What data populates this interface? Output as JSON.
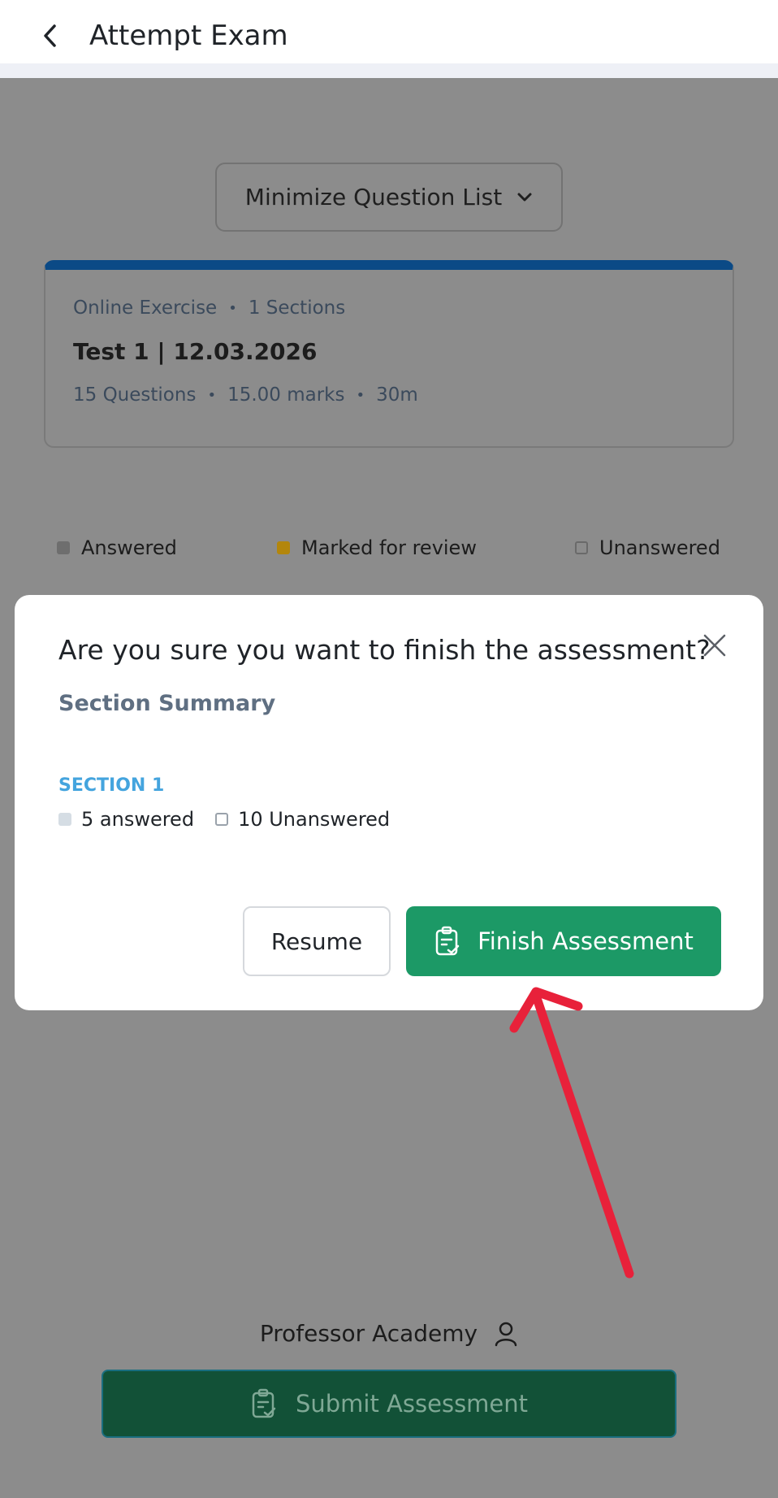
{
  "header": {
    "title": "Attempt Exam",
    "back_icon": "chevron-left-icon"
  },
  "question_list": {
    "toggle_label": "Minimize Question List",
    "toggle_icon": "chevron-down-icon"
  },
  "exam_card": {
    "type": "Online Exercise",
    "sections": "1 Sections",
    "title": "Test 1 | 12.03.2026",
    "questions": "15 Questions",
    "marks": "15.00 marks",
    "duration": "30m",
    "accent_color": "#0b4a86"
  },
  "legend": {
    "answered": "Answered",
    "marked": "Marked for review",
    "unanswered": "Unanswered",
    "marked_color": "#b3860c"
  },
  "modal": {
    "title": "Are you sure you want to finish the assessment?",
    "subtitle": "Section Summary",
    "section_name": "SECTION 1",
    "answered_text": "5 answered",
    "unanswered_text": "10 Unanswered",
    "resume_label": "Resume",
    "finish_label": "Finish Assessment",
    "finish_color": "#1c9966",
    "close_icon": "close-icon"
  },
  "footer": {
    "academy_name": "Professor Academy",
    "user_icon": "user-icon",
    "submit_label": "Submit Assessment",
    "submit_icon": "clipboard-check-icon"
  },
  "annotation": {
    "arrow_color": "#e8213a"
  }
}
